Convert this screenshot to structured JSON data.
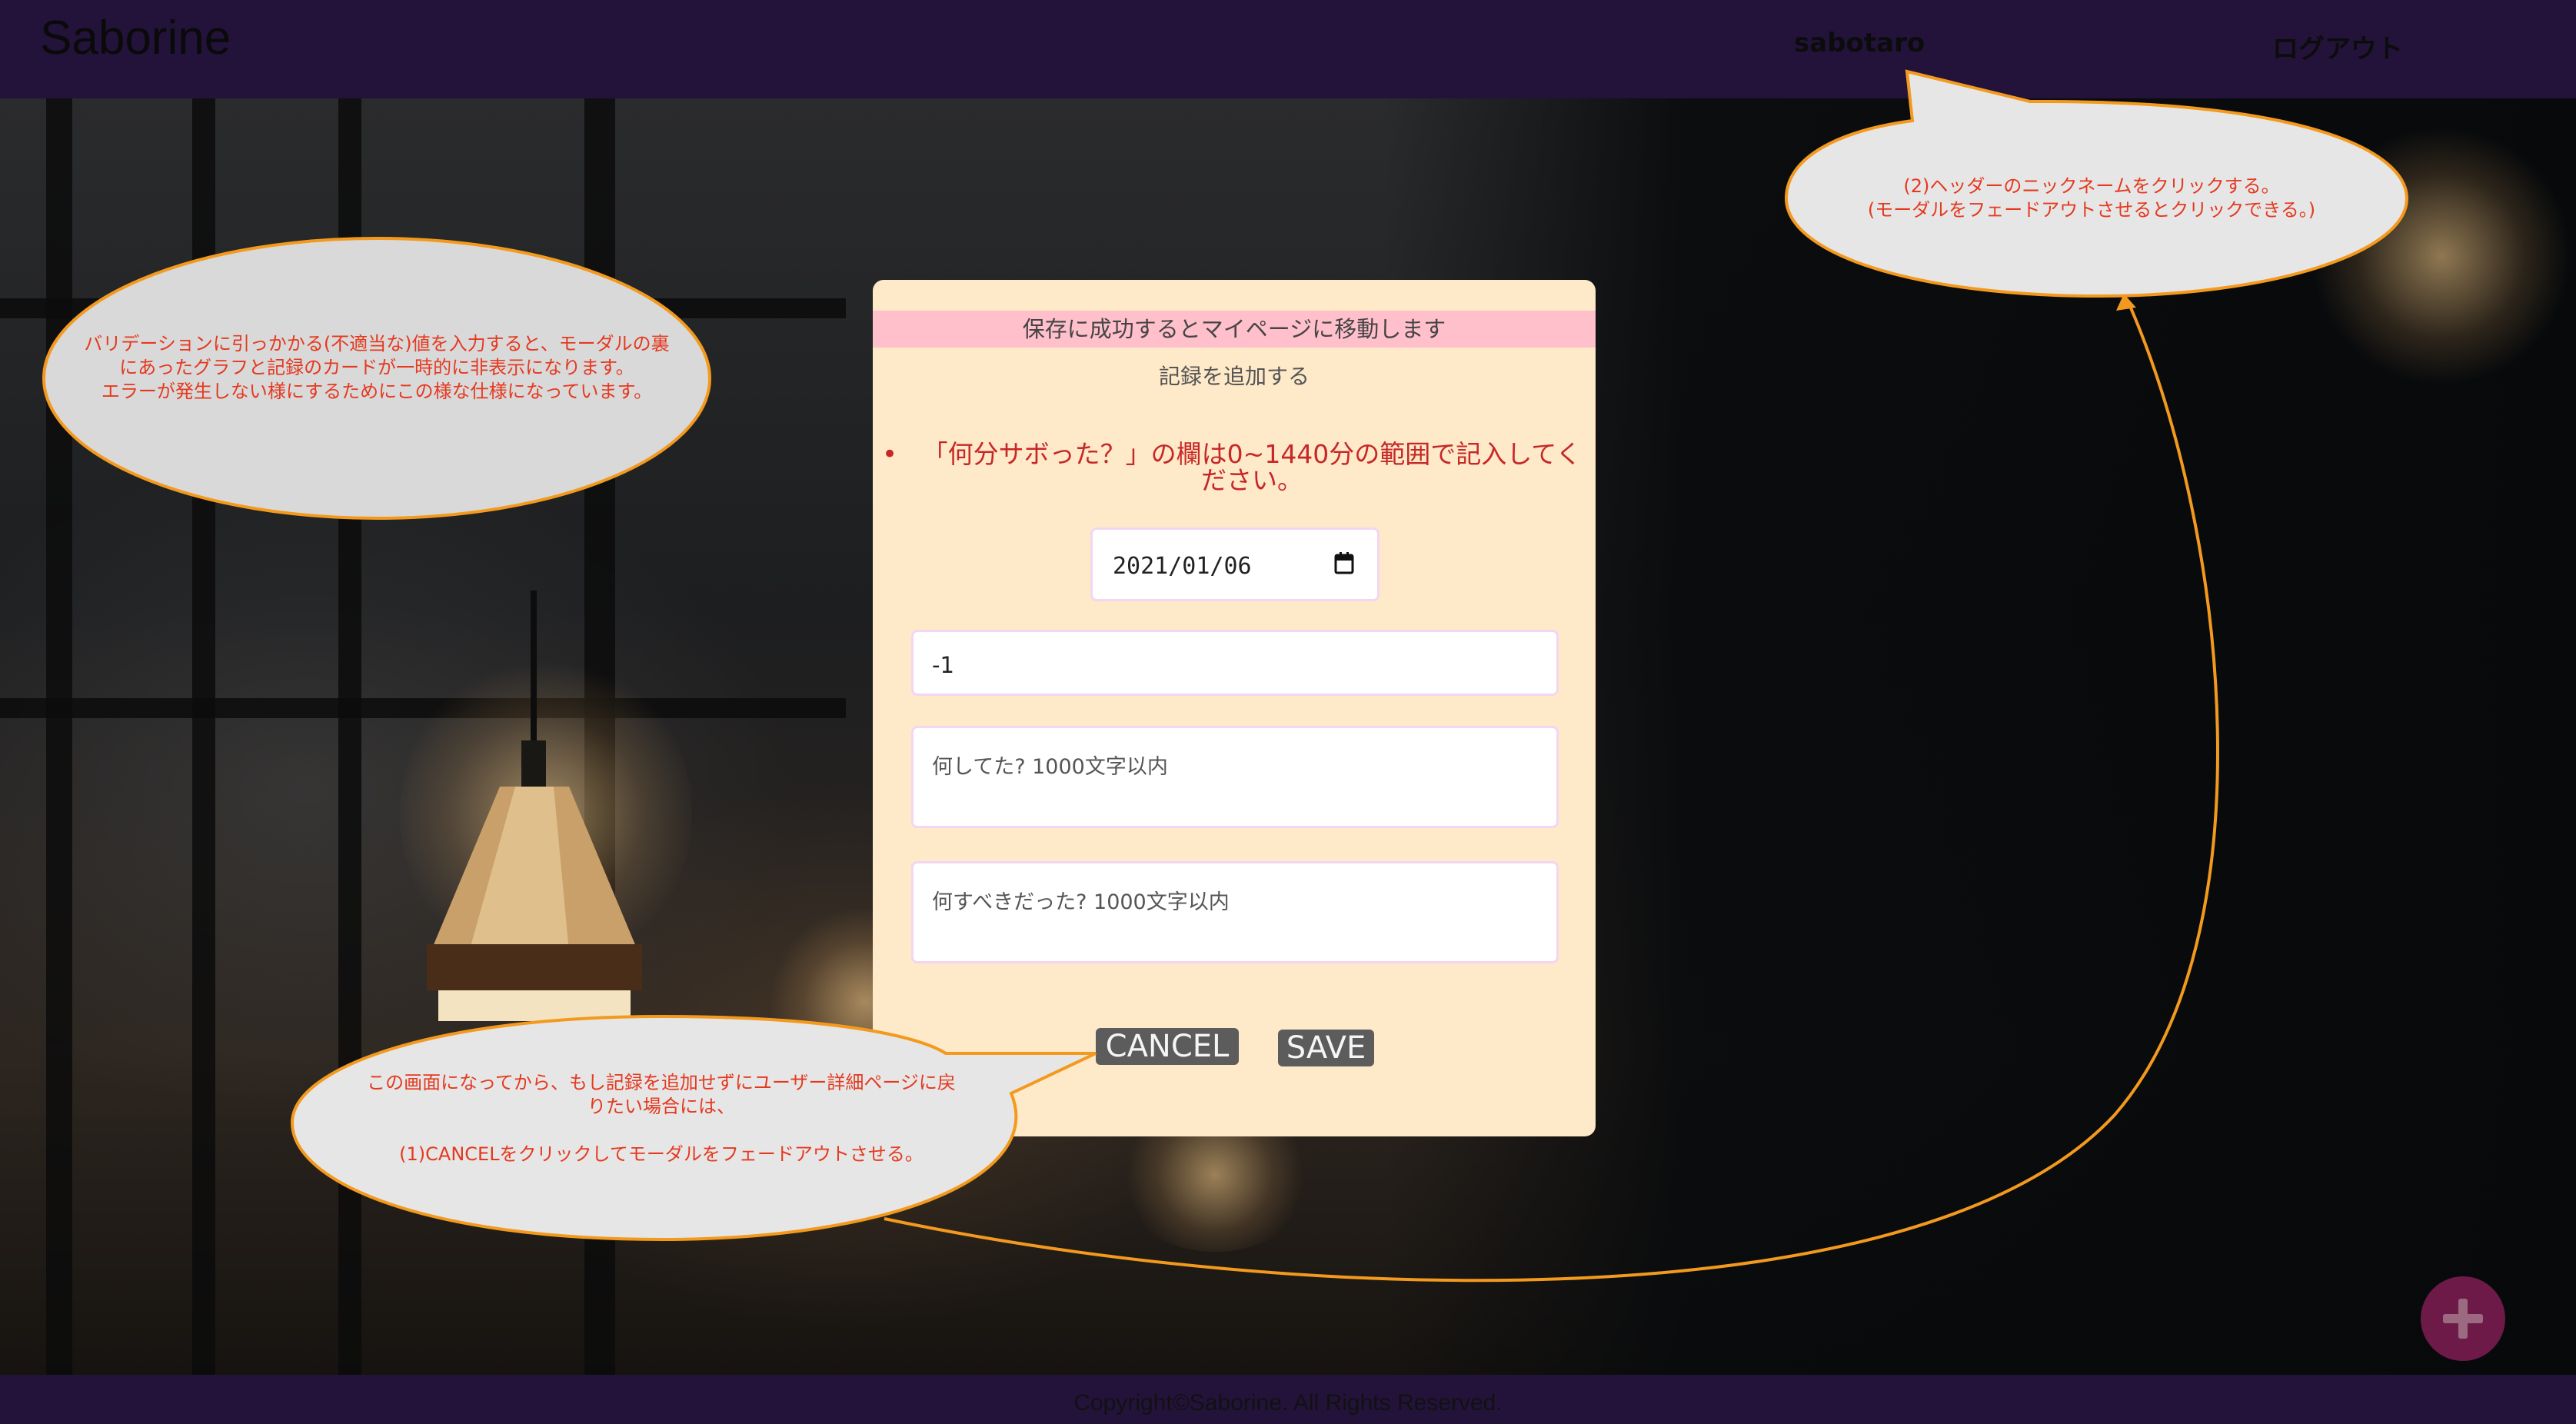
{
  "header": {
    "logo": "Saborine",
    "nickname": "sabotaro",
    "logout": "ログアウト"
  },
  "modal": {
    "banner": "保存に成功するとマイページに移動します",
    "title": "記録を追加する",
    "errors": [
      "「何分サボった？」の欄は0~1440分の範囲で記入してください。"
    ],
    "date_value": "2021/01/06",
    "minutes_value": "-1",
    "did_placeholder": "何してた? 1000文字以内",
    "should_placeholder": "何すべきだった? 1000文字以内",
    "cancel_label": "CANCEL",
    "save_label": "SAVE"
  },
  "footer": {
    "copyright": "Copyright©Saborine. All Rights Reserved."
  },
  "annotations": {
    "validation_note": [
      "バリデーションに引っかかる(不適当な)値を入力すると、モーダルの裏",
      "にあったグラフと記録のカードが一時的に非表示になります。",
      "エラーが発生しない様にするためにこの様な仕様になっています。"
    ],
    "cancel_note": [
      "この画面になってから、もし記録を追加せずにユーザー詳細ページに戻",
      "りたい場合には、",
      "",
      "(1)CANCELをクリックしてモーダルをフェードアウトさせる。"
    ],
    "header_note": [
      "(2)ヘッダーのニックネームをクリックする。",
      "(モーダルをフェードアウトさせるとクリックできる。)"
    ]
  },
  "colors": {
    "header_bg": "#23133a",
    "modal_bg": "#fee9c9",
    "banner_bg": "#ffc0cb",
    "error_text": "#c62828",
    "button_bg": "#5c5c5c",
    "annotation_stroke": "#f39a1e",
    "annotation_text": "#e5391f",
    "fab_bg": "#6d1a48"
  },
  "icons": {
    "date_picker": "calendar-icon",
    "fab": "plus-icon"
  }
}
